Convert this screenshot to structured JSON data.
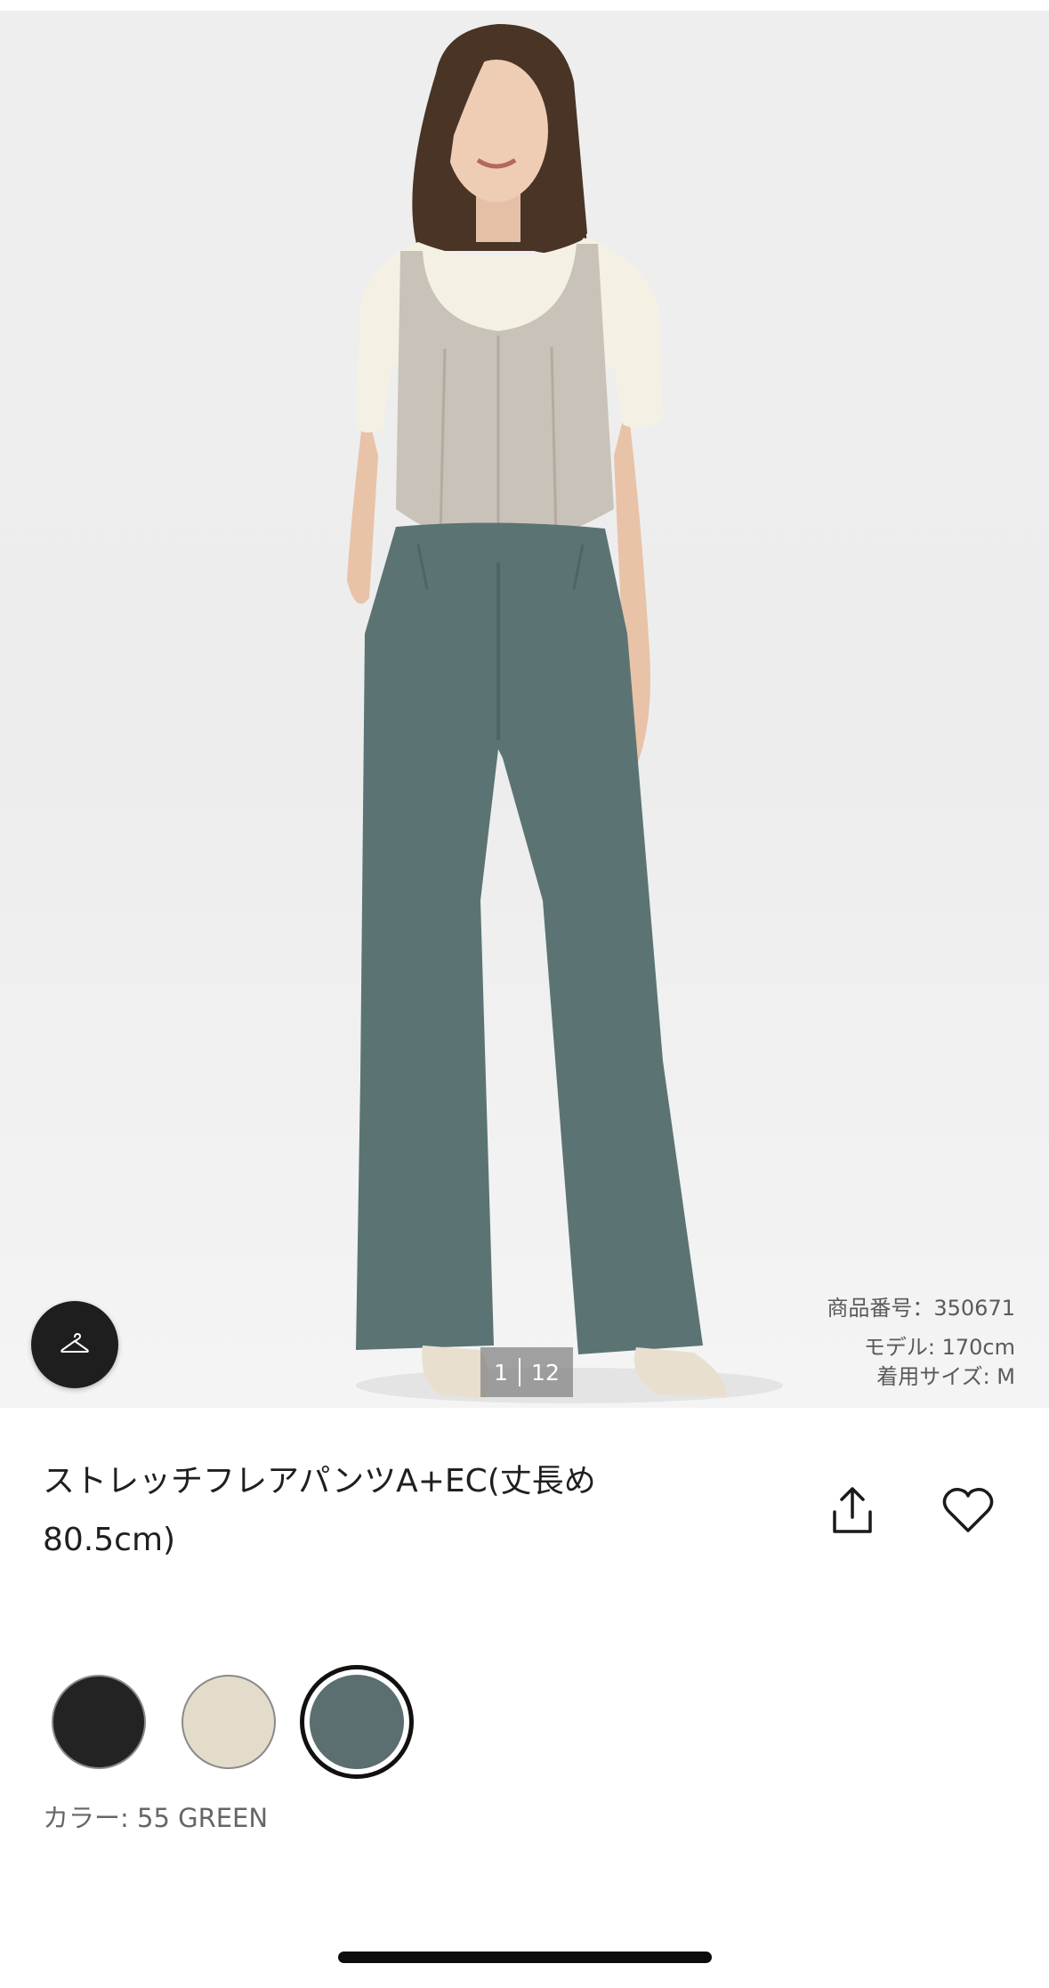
{
  "gallery": {
    "current": "1",
    "total": "12",
    "image_alt": "model wearing green flare pants"
  },
  "model_info": {
    "product_number": "商品番号：350671",
    "model_height": "モデル: 170cm",
    "worn_size": "着用サイズ: M"
  },
  "product": {
    "title_line1": "ストレッチフレアパンツA+EC(丈長め",
    "title_line2": "80.5cm)"
  },
  "actions": {
    "coordinate_icon": "hanger-icon",
    "share_icon": "share-icon",
    "favorite_icon": "heart-icon"
  },
  "colors": {
    "options": [
      {
        "name": "black",
        "hex": "#232323"
      },
      {
        "name": "beige",
        "hex": "#e3dccb"
      },
      {
        "name": "green",
        "hex": "#5b6e70"
      }
    ],
    "selected_index": 2,
    "label": "カラー: 55 GREEN"
  }
}
